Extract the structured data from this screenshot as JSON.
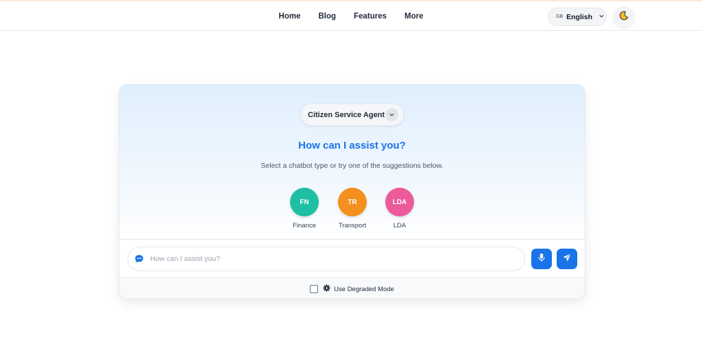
{
  "nav": {
    "links": [
      "Home",
      "Blog",
      "Features",
      "More"
    ],
    "language": {
      "code": "GB",
      "label": "English"
    },
    "theme_icon": "moon-icon"
  },
  "agent_select": {
    "label": "Citizen Service Agent",
    "icon": "chevron-down-icon"
  },
  "hero": {
    "title": "How can I assist you?",
    "subtitle": "Select a chatbot type or try one of the suggestions below."
  },
  "bots": [
    {
      "initials": "FN",
      "label": "Finance",
      "color": "#1fbfa3"
    },
    {
      "initials": "TR",
      "label": "Transport",
      "color": "#f5901e"
    },
    {
      "initials": "LDA",
      "label": "LDA",
      "color": "#ec5a9c"
    }
  ],
  "chat": {
    "placeholder": "How can I assist you?",
    "value": "",
    "icons": [
      "chat-bubble-icon",
      "microphone-icon",
      "send-icon"
    ]
  },
  "degraded_mode": {
    "label": "Use Degraded Mode",
    "checked": false,
    "icon": "gear-icon"
  },
  "colors": {
    "accent": "#1a73e8"
  }
}
